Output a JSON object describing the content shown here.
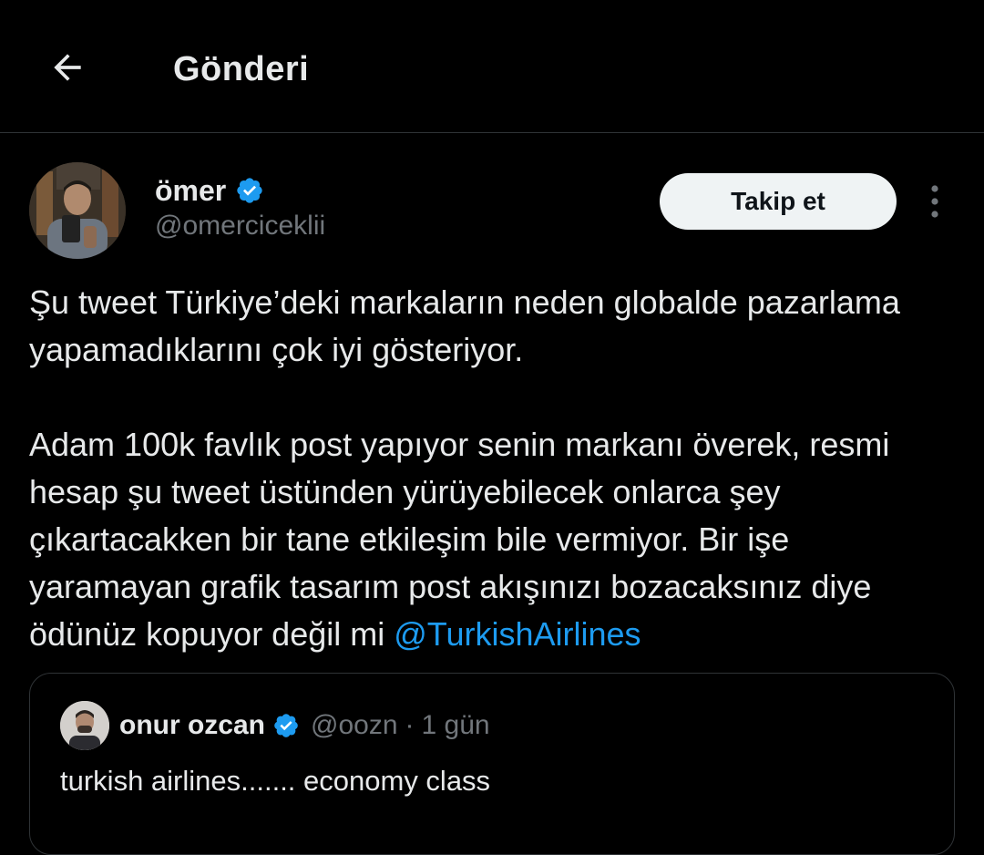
{
  "header": {
    "title": "Gönderi",
    "back_icon": "arrow-left-icon"
  },
  "post": {
    "author": {
      "display_name": "ömer",
      "handle": "@omerciceklii",
      "verified_icon": "verified-badge-icon",
      "avatar_icon": "avatar"
    },
    "follow_label": "Takip et",
    "more_icon": "more-vertical-icon",
    "paragraph1": "Şu tweet Türkiye’deki markaların neden globalde pazarlama yapamadıklarını çok iyi gösteriyor.",
    "paragraph2_text": "Adam 100k favlık post yapıyor senin markanı överek, resmi hesap şu tweet üstünden yürüyebilecek onlarca şey çıkartacakken bir tane etkileşim bile vermiyor. Bir işe yaramayan grafik tasarım post akışınızı bozacaksınız diye ödünüz kopuyor değil mi ",
    "mention": "@TurkishAirlines"
  },
  "quote": {
    "display_name": "onur ozcan",
    "handle": "@oozn",
    "separator": "·",
    "time": "1 gün",
    "text": "turkish airlines....... economy class"
  },
  "colors": {
    "background": "#000000",
    "text": "#e7e9ea",
    "secondary": "#71767b",
    "accent": "#1d9bf0",
    "border": "#2f3336",
    "button_bg": "#eff3f4"
  }
}
